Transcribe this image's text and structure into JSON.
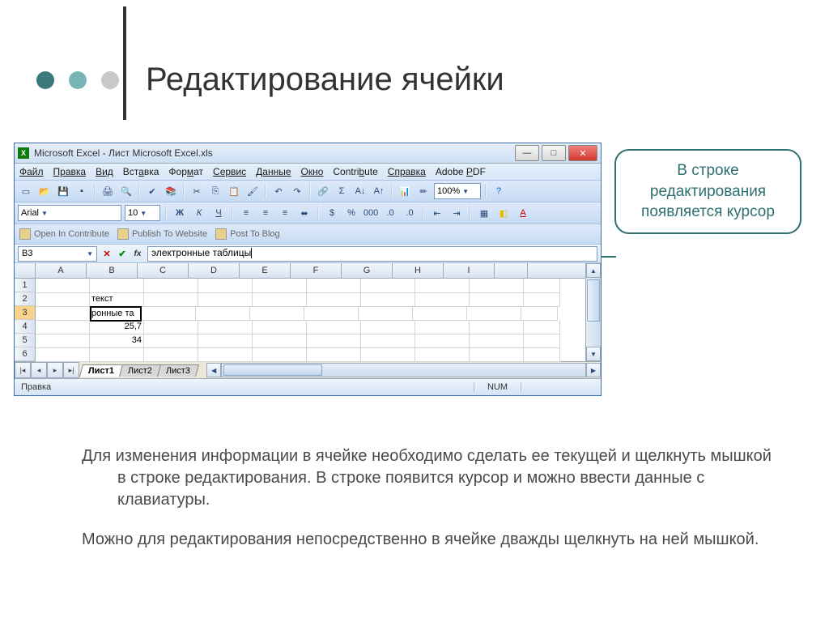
{
  "slide": {
    "title": "Редактирование ячейки"
  },
  "callout": {
    "text": "В строке редактирования появляется курсор"
  },
  "excel": {
    "title": "Microsoft Excel - Лист Microsoft Excel.xls",
    "menu": {
      "file": "Файл",
      "edit": "Правка",
      "view": "Вид",
      "insert": "Вставка",
      "format": "Формат",
      "tools": "Сервис",
      "data": "Данные",
      "window": "Окно",
      "contribute": "Contribute",
      "help": "Справка",
      "adobe": "Adobe PDF"
    },
    "font": {
      "name": "Arial",
      "size": "10"
    },
    "zoom": "100%",
    "contribute": {
      "open": "Open In Contribute",
      "publish": "Publish To Website",
      "post": "Post To Blog"
    },
    "namebox": "B3",
    "formula": "электронные таблицы",
    "columns": [
      "A",
      "B",
      "C",
      "D",
      "E",
      "F",
      "G",
      "H",
      "I"
    ],
    "rows": [
      "1",
      "2",
      "3",
      "4",
      "5",
      "6"
    ],
    "cells": {
      "b2": "текст",
      "b3": "ронные та",
      "b4": "25,7",
      "b5": "34"
    },
    "sheets": [
      "Лист1",
      "Лист2",
      "Лист3"
    ],
    "status": "Правка",
    "statusNum": "NUM"
  },
  "bodytext": {
    "p1": "Для изменения информации в ячейке необходимо сделать ее текущей и щелкнуть мышкой в строке редактирования.  В строке появится курсор и можно ввести данные с клавиатуры.",
    "p2": "Можно для редактирования непосредственно в ячейке дважды щелкнуть на ней мышкой."
  }
}
